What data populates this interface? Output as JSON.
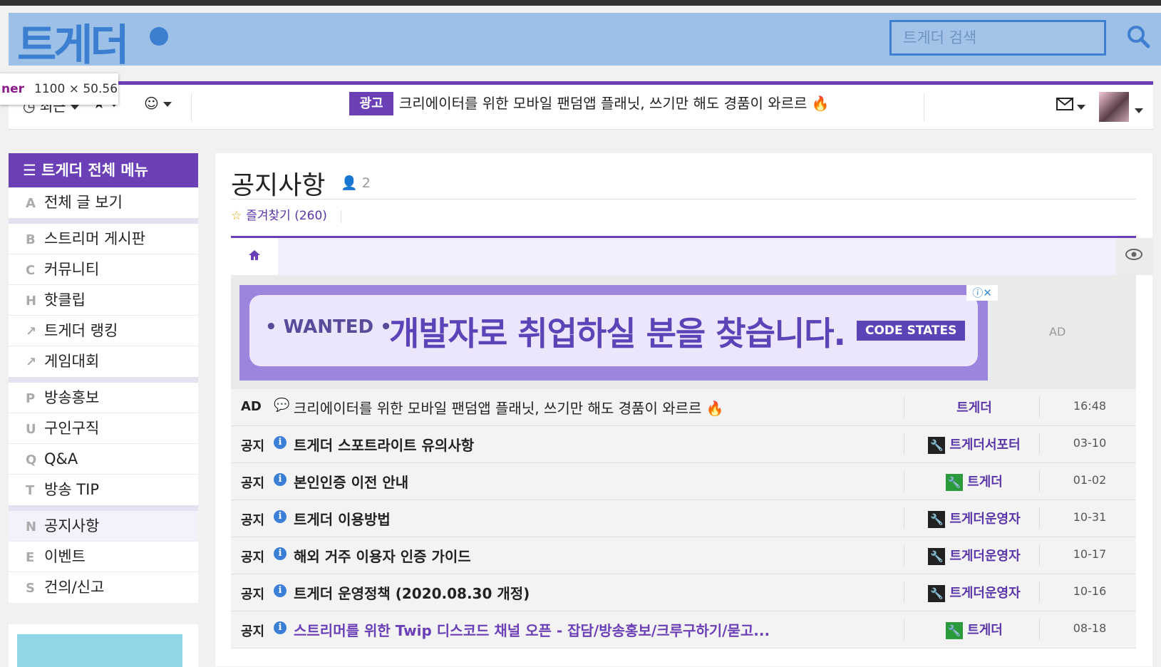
{
  "header": {
    "logo_text": "트게더",
    "search_placeholder": "트게더 검색"
  },
  "tooltip": {
    "name": "ner",
    "size": "1100 × 50.56"
  },
  "subnav": {
    "item1_label": "최근",
    "ad_badge": "광고",
    "ad_text": "크리에이터를 위한 모바일 팬덤앱 플래닛, 쓰기만 해도 경품이 와르르 🔥"
  },
  "sidebar": {
    "title": "트게더 전체 메뉴",
    "groups": [
      [
        {
          "key": "A",
          "label": "전체 글 보기"
        }
      ],
      [
        {
          "key": "B",
          "label": "스트리머 게시판"
        },
        {
          "key": "C",
          "label": "커뮤니티"
        },
        {
          "key": "H",
          "label": "핫클립"
        },
        {
          "key": "↗",
          "label": "트게더 랭킹"
        },
        {
          "key": "↗",
          "label": "게임대회"
        }
      ],
      [
        {
          "key": "P",
          "label": "방송홍보"
        },
        {
          "key": "U",
          "label": "구인구직"
        },
        {
          "key": "Q",
          "label": "Q&A"
        },
        {
          "key": "T",
          "label": "방송 TIP"
        }
      ],
      [
        {
          "key": "N",
          "label": "공지사항"
        },
        {
          "key": "E",
          "label": "이벤트"
        },
        {
          "key": "S",
          "label": "건의/신고"
        }
      ]
    ]
  },
  "board": {
    "title": "공지사항",
    "users": "2",
    "favorite": "즐겨찾기 (260)"
  },
  "ad_banner": {
    "wanted": "• WANTED •",
    "message": "개발자로 취업하실 분을 찾습니다.",
    "brand": "CODE STATES",
    "label": "AD"
  },
  "posts": [
    {
      "prefix": "AD",
      "title": "크리에이터를 위한 모바일 팬덤앱 플래닛, 쓰기만 해도 경품이 와르르 🔥",
      "author": "트게더",
      "date": "16:48"
    },
    {
      "prefix": "공지",
      "title": "트게더 스포트라이트 유의사항",
      "author": "트게더서포터",
      "date": "03-10"
    },
    {
      "prefix": "공지",
      "title": "본인인증 이전 안내",
      "author": "트게더",
      "date": "01-02"
    },
    {
      "prefix": "공지",
      "title": "트게더 이용방법",
      "author": "트게더운영자",
      "date": "10-31"
    },
    {
      "prefix": "공지",
      "title": "해외 거주 이용자 인증 가이드",
      "author": "트게더운영자",
      "date": "10-17"
    },
    {
      "prefix": "공지",
      "title": "트게더 운영정책 (2020.08.30 개정)",
      "author": "트게더운영자",
      "date": "10-16"
    },
    {
      "prefix": "공지",
      "title": "스트리머를 위한 Twip 디스코드 채널 오픈 - 잡담/방송홍보/크루구하기/묻고...",
      "author": "트게더",
      "date": "08-18"
    }
  ],
  "colors": {
    "accent": "#6b3fb5",
    "header_bg": "#9cc0e6",
    "logo": "#3c7fd1"
  }
}
